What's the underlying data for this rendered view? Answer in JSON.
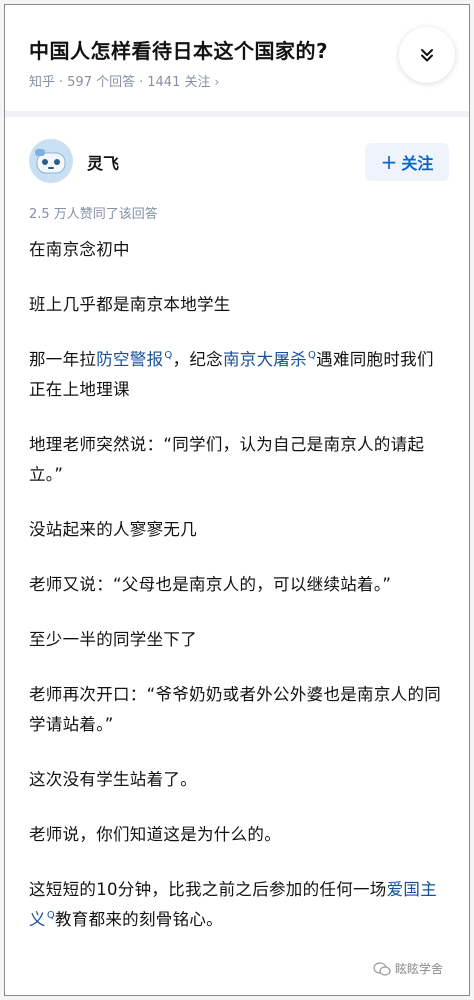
{
  "question": {
    "title": "中国人怎样看待日本这个国家的?",
    "platform": "知乎",
    "answers": "597 个回答",
    "followers": "1441 关注",
    "chevron": "›"
  },
  "author": {
    "name": "灵飞",
    "follow_label": "关注",
    "avatar_icon": "cartoon-avatar-icon"
  },
  "vote_text": "2.5 万人赞同了该回答",
  "article": {
    "p1": "在南京念初中",
    "p2": "班上几乎都是南京本地学生",
    "p3_a": "那一年拉",
    "p3_link1": "防空警报",
    "p3_b": "，纪念",
    "p3_link2": "南京大屠杀",
    "p3_c": "遇难同胞时我们正在上地理课",
    "p4": "地理老师突然说：“同学们，认为自己是南京人的请起立。”",
    "p5": "没站起来的人寥寥无几",
    "p6": "老师又说：“父母也是南京人的，可以继续站着。”",
    "p7": "至少一半的同学坐下了",
    "p8": "老师再次开口：“爷爷奶奶或者外公外婆也是南京人的同学请站着。”",
    "p9": "这次没有学生站着了。",
    "p10": "老师说，你们知道这是为什么的。",
    "p11_a": "这短短的10分钟，比我之前之后参加的任何一场",
    "p11_link": "爱国主义",
    "p11_b": "教育都来的刻骨铭心。",
    "search_marker": "Q"
  },
  "watermark": "眩眩学舍",
  "colors": {
    "link": "#175199",
    "follow_text": "#0a66c2",
    "meta": "#8590a6"
  }
}
